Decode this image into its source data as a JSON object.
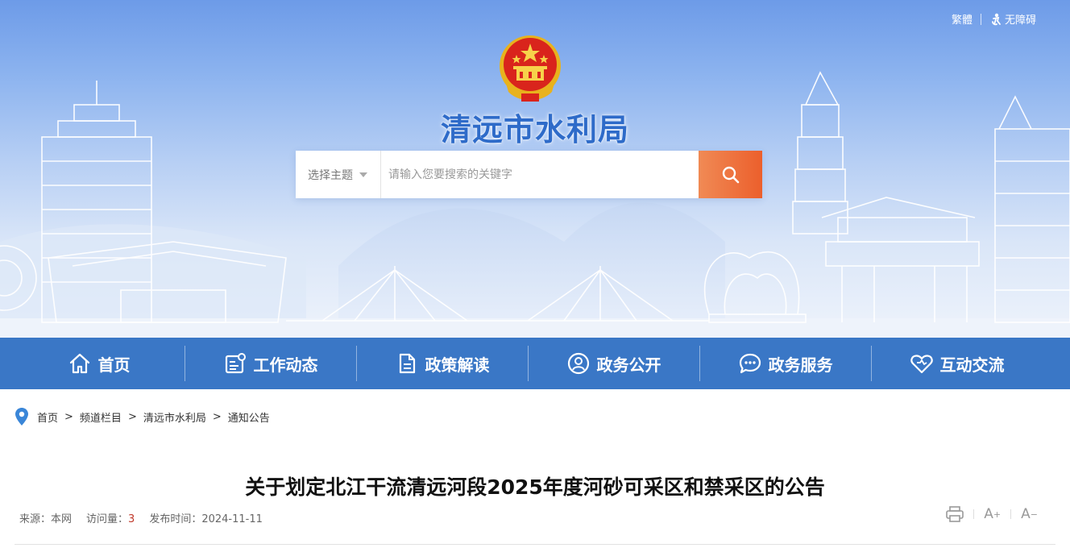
{
  "topbar": {
    "traditional": "繁體",
    "accessibility": "无障碍"
  },
  "site": {
    "title": "清远市水利局"
  },
  "search": {
    "topic_label": "选择主题",
    "placeholder": "请输入您要搜索的关键字",
    "button_icon": "search-icon"
  },
  "nav": [
    {
      "label": "首页",
      "icon": "home-icon"
    },
    {
      "label": "工作动态",
      "icon": "news-icon"
    },
    {
      "label": "政策解读",
      "icon": "document-icon"
    },
    {
      "label": "政务公开",
      "icon": "user-icon"
    },
    {
      "label": "政务服务",
      "icon": "chat-icon"
    },
    {
      "label": "互动交流",
      "icon": "heart-icon"
    }
  ],
  "breadcrumb": [
    "首页",
    "频道栏目",
    "清远市水利局",
    "通知公告"
  ],
  "article": {
    "title": "关于划定北江干流清远河段2025年度河砂可采区和禁采区的公告",
    "source_label": "来源：",
    "source": "本网",
    "views_label": "访问量：",
    "views": "3",
    "date_label": "发布时间：",
    "date": "2024-11-11"
  },
  "colors": {
    "nav_bg": "#3a77c6",
    "title_blue": "#2e6bc9",
    "search_button": "#ec5f2c"
  }
}
